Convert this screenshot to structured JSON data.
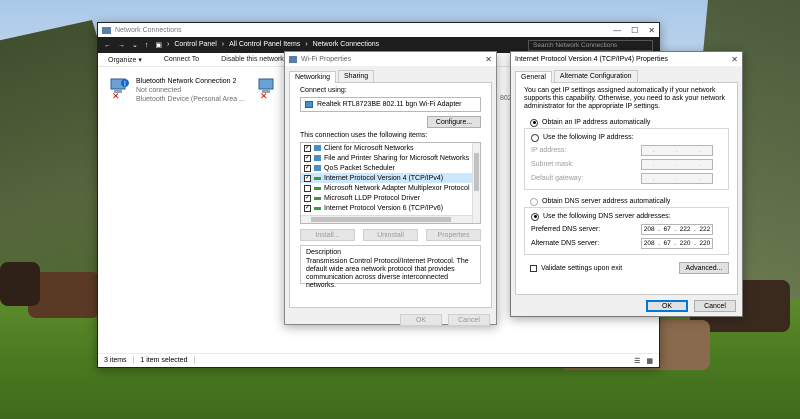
{
  "net": {
    "title": "Network Connections",
    "breadcrumb": [
      "Control Panel",
      "All Control Panel Items",
      "Network Connections"
    ],
    "search_placeholder": "Search Network Connections",
    "commands": [
      "Organize ▾",
      "Connect To",
      "Disable this network d"
    ],
    "connections": [
      {
        "name": "Bluetooth Network Connection 2",
        "status": "Not connected",
        "device": "Bluetooth Device (Personal Area ..."
      },
      {
        "name": "",
        "status": "",
        "device": ""
      }
    ],
    "partial_right": "802.11",
    "status_items": "3 items",
    "status_selected": "1 item selected"
  },
  "wifi": {
    "title": "Wi-Fi Properties",
    "tabs": [
      "Networking",
      "Sharing"
    ],
    "connect_using_label": "Connect using:",
    "adapter": "Realtek RTL8723BE 802.11 bgn Wi-Fi Adapter",
    "configure": "Configure...",
    "items_label": "This connection uses the following items:",
    "items": [
      {
        "label": "Client for Microsoft Networks",
        "checked": true
      },
      {
        "label": "File and Printer Sharing for Microsoft Networks",
        "checked": true
      },
      {
        "label": "QoS Packet Scheduler",
        "checked": true
      },
      {
        "label": "Internet Protocol Version 4 (TCP/IPv4)",
        "checked": true
      },
      {
        "label": "Microsoft Network Adapter Multiplexor Protocol",
        "checked": false
      },
      {
        "label": "Microsoft LLDP Protocol Driver",
        "checked": true
      },
      {
        "label": "Internet Protocol Version 6 (TCP/IPv6)",
        "checked": true
      }
    ],
    "install": "Install...",
    "uninstall": "Uninstall",
    "properties": "Properties",
    "description_title": "Description",
    "description": "Transmission Control Protocol/Internet Protocol. The default wide area network protocol that provides communication across diverse interconnected networks.",
    "ok": "OK",
    "cancel": "Cancel"
  },
  "ipv4": {
    "title": "Internet Protocol Version 4 (TCP/IPv4) Properties",
    "tabs": [
      "General",
      "Alternate Configuration"
    ],
    "intro": "You can get IP settings assigned automatically if your network supports this capability. Otherwise, you need to ask your network administrator for the appropriate IP settings.",
    "obtain_ip": "Obtain an IP address automatically",
    "use_ip": "Use the following IP address:",
    "ip_label": "IP address:",
    "subnet_label": "Subnet mask:",
    "gateway_label": "Default gateway:",
    "obtain_dns": "Obtain DNS server address automatically",
    "use_dns": "Use the following DNS server addresses:",
    "pref_dns_label": "Preferred DNS server:",
    "pref_dns": [
      "208",
      "67",
      "222",
      "222"
    ],
    "alt_dns_label": "Alternate DNS server:",
    "alt_dns": [
      "208",
      "67",
      "220",
      "220"
    ],
    "validate": "Validate settings upon exit",
    "advanced": "Advanced...",
    "ok": "OK",
    "cancel": "Cancel"
  }
}
